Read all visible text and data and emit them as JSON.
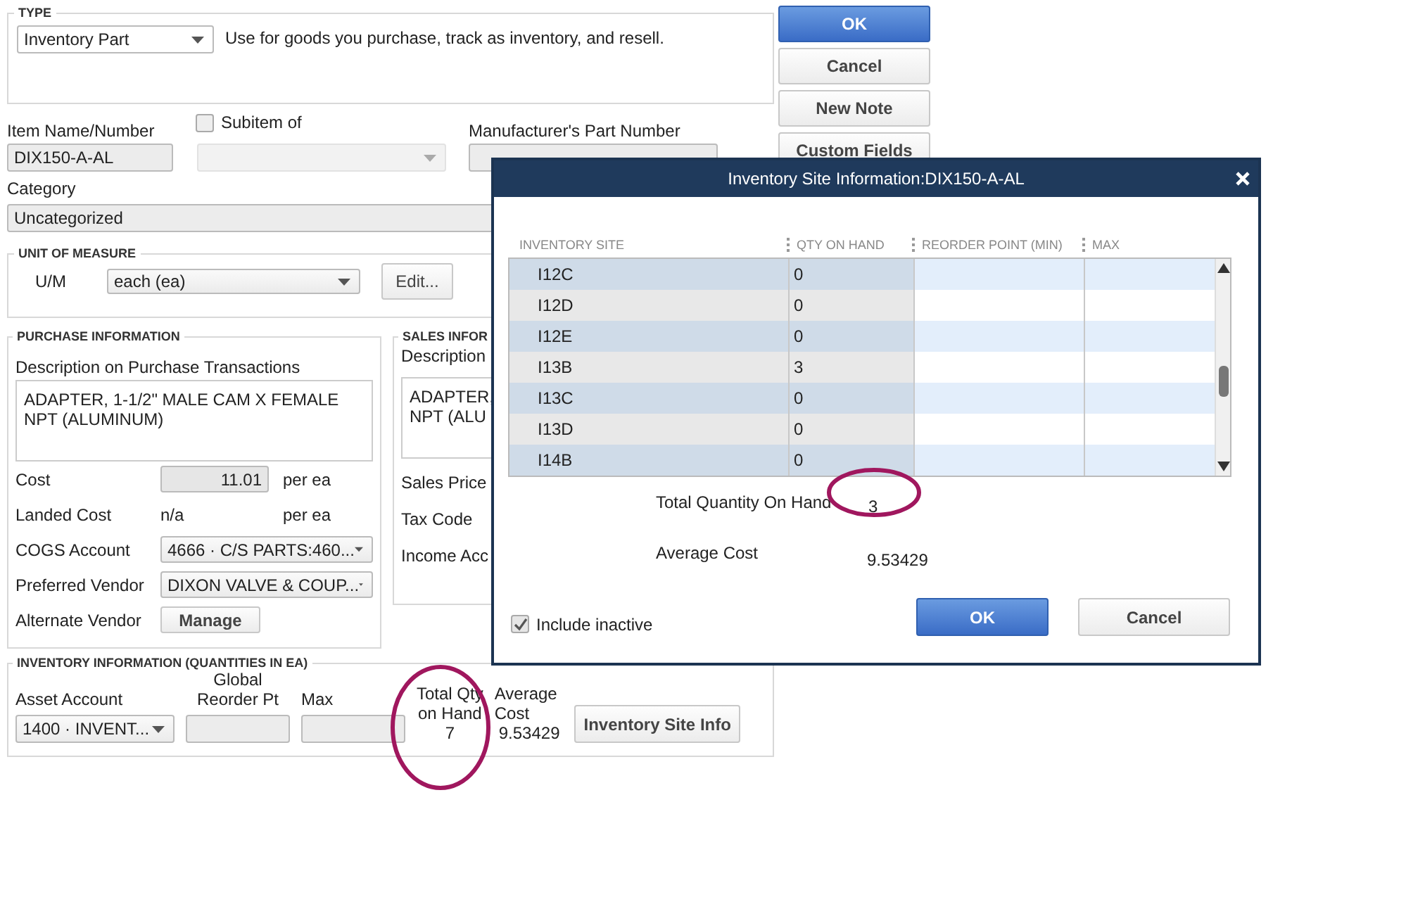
{
  "main_buttons": [
    {
      "label": "OK",
      "kind": "primary"
    },
    {
      "label": "Cancel",
      "kind": "normal"
    },
    {
      "label": "New Note",
      "kind": "normal"
    },
    {
      "label": "Custom Fields",
      "kind": "normal"
    }
  ],
  "type_section": {
    "legend": "TYPE",
    "value": "Inventory Part",
    "description": "Use for goods you purchase, track as inventory, and resell."
  },
  "item_name": {
    "label": "Item Name/Number",
    "value": "DIX150-A-AL"
  },
  "subitem": {
    "label": "Subitem of",
    "checked": false
  },
  "manufacturer_part": {
    "label": "Manufacturer's Part Number"
  },
  "category": {
    "label": "Category",
    "value": "Uncategorized"
  },
  "unit_of_measure": {
    "legend": "UNIT OF MEASURE",
    "label": "U/M",
    "value": "each (ea)",
    "button": "Edit..."
  },
  "purchase": {
    "legend": "PURCHASE INFORMATION",
    "description_label": "Description on Purchase Transactions",
    "description": "ADAPTER, 1-1/2\" MALE CAM X FEMALE\nNPT (ALUMINUM)",
    "fields": [
      {
        "label": "Cost",
        "kind": "input",
        "value": "11.01",
        "suffix": "per ea"
      },
      {
        "label": "Landed Cost",
        "kind": "text",
        "value": "n/a",
        "suffix": "per ea"
      },
      {
        "label": "COGS Account",
        "kind": "dropdown",
        "value": "4666 · C/S PARTS:460..."
      },
      {
        "label": "Preferred Vendor",
        "kind": "dropdown",
        "value": "DIXON VALVE & COUP..."
      },
      {
        "label": "Alternate Vendor",
        "kind": "button",
        "value": "Manage"
      }
    ]
  },
  "sales": {
    "legend": "SALES INFOR",
    "description_label": "Description",
    "description": "ADAPTER,\nNPT (ALU",
    "labels": [
      "Sales Price",
      "Tax Code",
      "Income Acc"
    ]
  },
  "inventory": {
    "legend": "INVENTORY INFORMATION (QUANTITIES IN EA)",
    "asset_label": "Asset Account",
    "asset_value": "1400 · INVENT...",
    "reorder_label": "Global\nReorder Pt",
    "max_label": "Max",
    "total_label": "Total Qty\non Hand",
    "total_value": "7",
    "average_label": "Average\nCost",
    "average_value": "9.53429",
    "button": "Inventory Site Info"
  },
  "dialog": {
    "title": "Inventory Site Information:DIX150-A-AL",
    "columns": [
      "INVENTORY SITE",
      "QTY ON HAND",
      "REORDER POINT (MIN)",
      "MAX"
    ],
    "rows": [
      {
        "site": "I12C",
        "qty": "0"
      },
      {
        "site": "I12D",
        "qty": "0"
      },
      {
        "site": "I12E",
        "qty": "0"
      },
      {
        "site": "I13B",
        "qty": "3"
      },
      {
        "site": "I13C",
        "qty": "0"
      },
      {
        "site": "I13D",
        "qty": "0"
      },
      {
        "site": "I14B",
        "qty": "0"
      }
    ],
    "total_label": "Total Quantity On Hand",
    "total_value": "3",
    "average_label": "Average Cost",
    "average_value": "9.53429",
    "include_inactive": {
      "label": "Include inactive",
      "checked": true
    },
    "buttons": [
      {
        "label": "OK",
        "kind": "primary"
      },
      {
        "label": "Cancel",
        "kind": "normal"
      }
    ]
  }
}
